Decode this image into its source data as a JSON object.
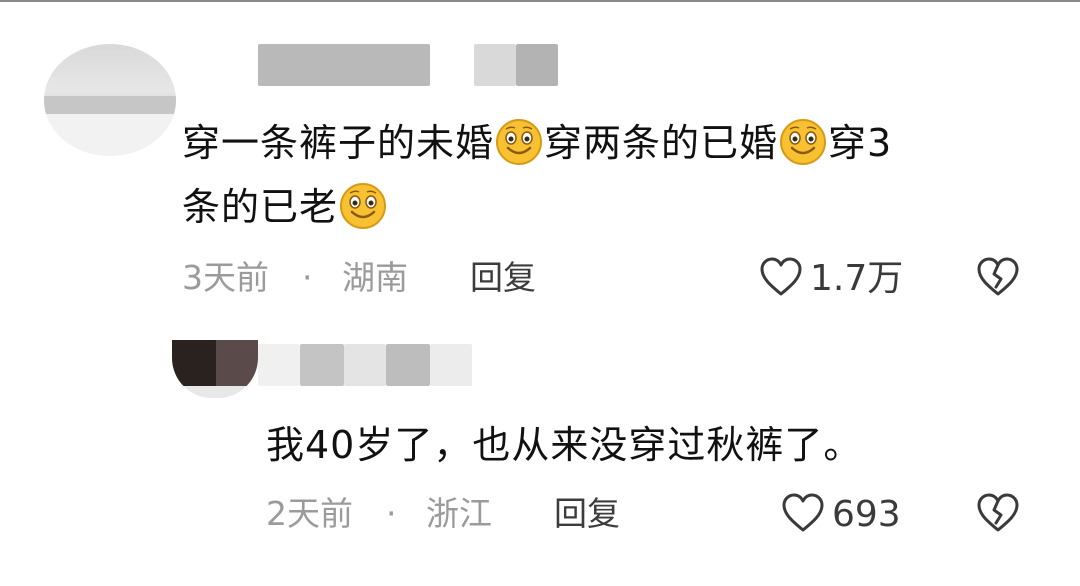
{
  "comments": [
    {
      "text_line1": "穿一条裤子的未婚",
      "text_mid1": "穿两条的已婚",
      "text_mid2": "穿3",
      "text_line2": "条的已老",
      "emoji": "smile-emoji-icon",
      "time": "3天前",
      "separator": "·",
      "location": "湖南",
      "reply_label": "回复",
      "likes": "1.7万"
    },
    {
      "text": "我40岁了，也从来没穿过秋裤了。",
      "time": "2天前",
      "separator": "·",
      "location": "浙江",
      "reply_label": "回复",
      "likes": "693"
    }
  ],
  "icons": {
    "like": "heart-outline-icon",
    "dislike": "broken-heart-icon",
    "emoji": "smile-emoji-icon"
  },
  "colors": {
    "text": "#111111",
    "meta": "#9b9b9b",
    "icon": "#3a3a3a",
    "emoji_face": "#f8c132"
  }
}
